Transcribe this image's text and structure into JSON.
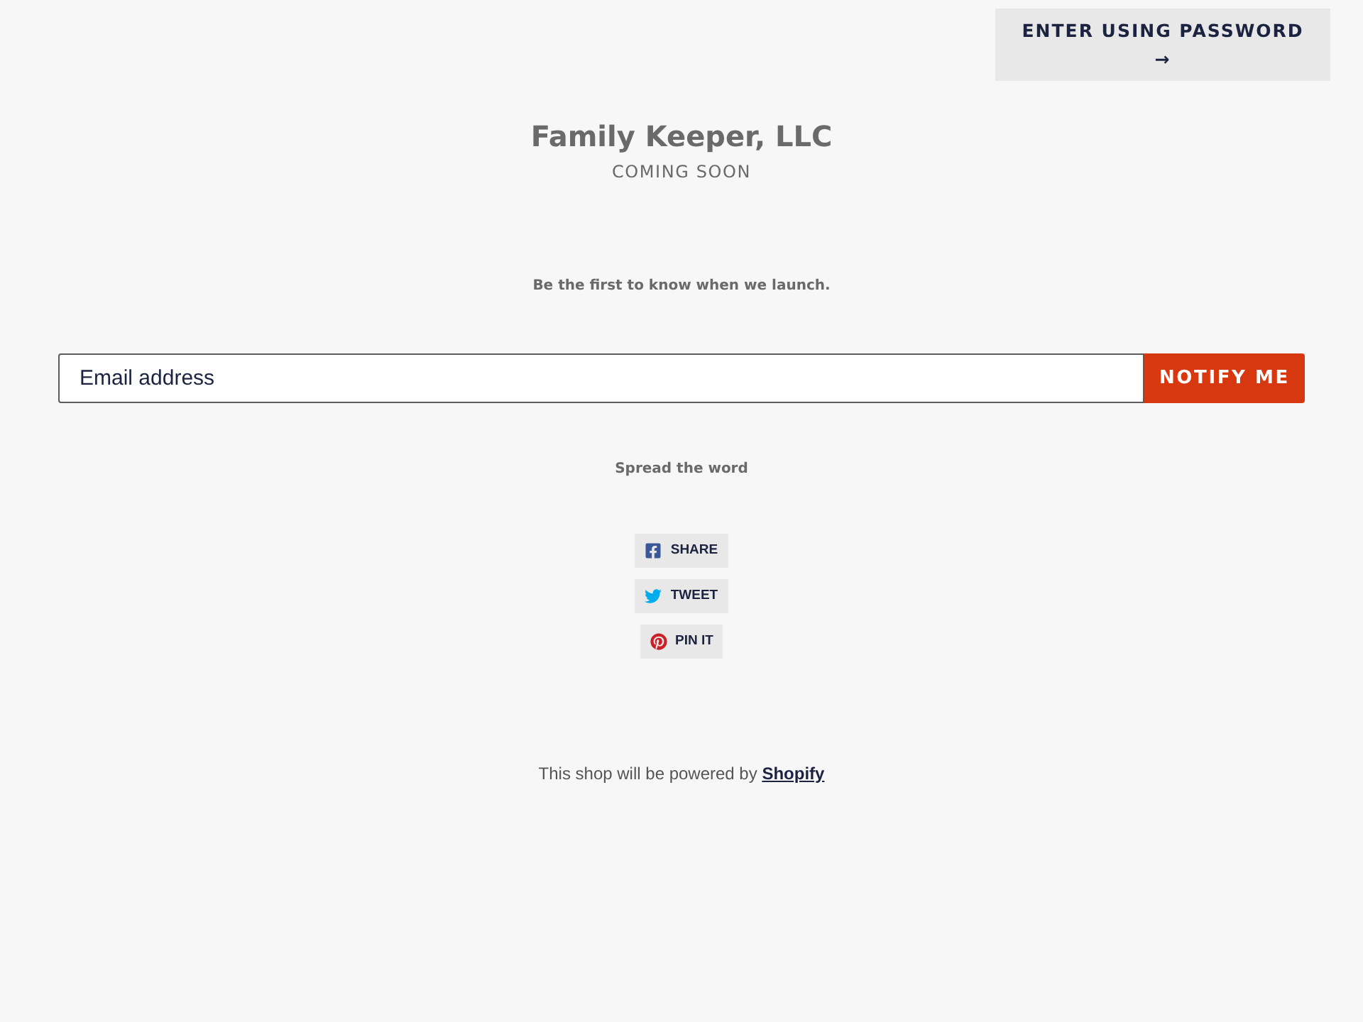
{
  "header": {
    "password_button": "ENTER USING PASSWORD →"
  },
  "hero": {
    "title": "Family Keeper, LLC",
    "subtitle": "COMING SOON",
    "tagline": "Be the first to know when we launch."
  },
  "signup": {
    "email": {
      "placeholder": "Email address"
    },
    "button": "NOTIFY ME"
  },
  "share": {
    "heading": "Spread the word",
    "buttons": [
      {
        "kind": "facebook",
        "label": "SHARE"
      },
      {
        "kind": "twitter",
        "label": "TWEET"
      },
      {
        "kind": "pinterest",
        "label": "PIN IT"
      }
    ]
  },
  "footer": {
    "text": "This shop will be powered by",
    "link": "Shopify"
  }
}
